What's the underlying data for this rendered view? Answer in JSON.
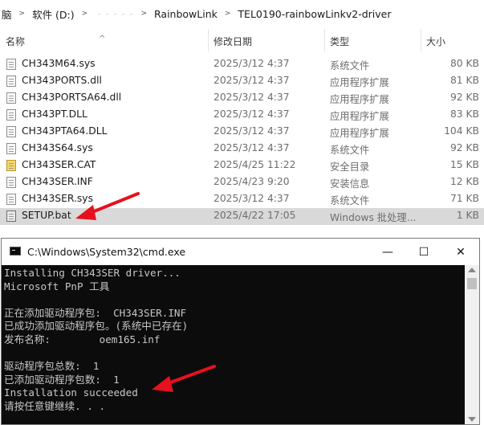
{
  "breadcrumb": [
    "脑",
    "软件 (D:)",
    " · · · · ·",
    "RainbowLink",
    "TEL0190-rainbowLinkv2-driver"
  ],
  "columns": {
    "name": "名称",
    "date": "修改日期",
    "type": "类型",
    "size": "大小"
  },
  "files": [
    {
      "name": "CH343M64.sys",
      "date": "2025/3/12 4:37",
      "type": "系统文件",
      "size": "80 KB",
      "icon": "sys-file-icon"
    },
    {
      "name": "CH343PORTS.dll",
      "date": "2025/3/12 4:37",
      "type": "应用程序扩展",
      "size": "81 KB",
      "icon": "dll-file-icon"
    },
    {
      "name": "CH343PORTSA64.dll",
      "date": "2025/3/12 4:37",
      "type": "应用程序扩展",
      "size": "92 KB",
      "icon": "dll-file-icon"
    },
    {
      "name": "CH343PT.DLL",
      "date": "2025/3/12 4:37",
      "type": "应用程序扩展",
      "size": "83 KB",
      "icon": "dll-file-icon"
    },
    {
      "name": "CH343PTA64.DLL",
      "date": "2025/3/12 4:37",
      "type": "应用程序扩展",
      "size": "104 KB",
      "icon": "dll-file-icon"
    },
    {
      "name": "CH343S64.sys",
      "date": "2025/3/12 4:37",
      "type": "系统文件",
      "size": "92 KB",
      "icon": "sys-file-icon"
    },
    {
      "name": "CH343SER.CAT",
      "date": "2025/4/25 11:22",
      "type": "安全目录",
      "size": "15 KB",
      "icon": "catalog-file-icon"
    },
    {
      "name": "CH343SER.INF",
      "date": "2025/4/23 9:20",
      "type": "安装信息",
      "size": "12 KB",
      "icon": "inf-file-icon"
    },
    {
      "name": "CH343SER.sys",
      "date": "2025/3/12 4:37",
      "type": "系统文件",
      "size": "71 KB",
      "icon": "sys-file-icon"
    },
    {
      "name": "SETUP.bat",
      "date": "2025/4/22 17:05",
      "type": "Windows 批处理...",
      "size": "1 KB",
      "icon": "batch-file-icon",
      "selected": true
    }
  ],
  "cmd": {
    "title": "C:\\Windows\\System32\\cmd.exe",
    "minimize": "—",
    "maximize": "☐",
    "close": "✕",
    "lines": [
      "Installing CH343SER driver...",
      "Microsoft PnP 工具",
      "",
      "正在添加驱动程序包:  CH343SER.INF",
      "已成功添加驱动程序包。(系统中已存在)",
      "发布名称:        oem165.inf",
      "",
      "驱动程序包总数:  1",
      "已添加驱动程序包数:  1",
      "Installation succeeded",
      "请按任意键继续. . ."
    ]
  },
  "colors": {
    "annotation_arrow": "#e8101e",
    "selection": "#d9d9d9",
    "console_bg": "#0c0c0c"
  }
}
